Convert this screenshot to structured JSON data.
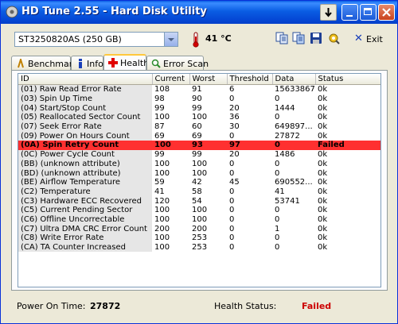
{
  "window": {
    "title": "HD Tune 2.55 - Hard Disk Utility"
  },
  "toolbar": {
    "drive": "ST3250820AS (250 GB)",
    "temperature": "41 °C",
    "exit_label": "Exit"
  },
  "tabs": [
    {
      "label": "Benchmark"
    },
    {
      "label": "Info"
    },
    {
      "label": "Health"
    },
    {
      "label": "Error Scan"
    }
  ],
  "table": {
    "columns": [
      "ID",
      "Current",
      "Worst",
      "Threshold",
      "Data",
      "Status"
    ],
    "rows": [
      [
        "(01) Raw Read Error Rate",
        "108",
        "91",
        "6",
        "15633867",
        "0k"
      ],
      [
        "(03) Spin Up Time",
        "98",
        "90",
        "0",
        "0",
        "0k"
      ],
      [
        "(04) Start/Stop Count",
        "99",
        "99",
        "20",
        "1444",
        "0k"
      ],
      [
        "(05) Reallocated Sector Count",
        "100",
        "100",
        "36",
        "0",
        "0k"
      ],
      [
        "(07) Seek Error Rate",
        "87",
        "60",
        "30",
        "649897...",
        "0k"
      ],
      [
        "(09) Power On Hours Count",
        "69",
        "69",
        "0",
        "27872",
        "0k"
      ],
      [
        "(0A) Spin Retry Count",
        "100",
        "93",
        "97",
        "0",
        "Failed"
      ],
      [
        "(0C) Power Cycle Count",
        "99",
        "99",
        "20",
        "1486",
        "0k"
      ],
      [
        "(BB) (unknown attribute)",
        "100",
        "100",
        "0",
        "0",
        "0k"
      ],
      [
        "(BD) (unknown attribute)",
        "100",
        "100",
        "0",
        "0",
        "0k"
      ],
      [
        "(BE) Airflow Temperature",
        "59",
        "42",
        "45",
        "690552...",
        "0k"
      ],
      [
        "(C2) Temperature",
        "41",
        "58",
        "0",
        "41",
        "0k"
      ],
      [
        "(C3) Hardware ECC Recovered",
        "120",
        "54",
        "0",
        "53741",
        "0k"
      ],
      [
        "(C5) Current Pending Sector",
        "100",
        "100",
        "0",
        "0",
        "0k"
      ],
      [
        "(C6) Offline Uncorrectable",
        "100",
        "100",
        "0",
        "0",
        "0k"
      ],
      [
        "(C7) Ultra DMA CRC Error Count",
        "200",
        "200",
        "0",
        "1",
        "0k"
      ],
      [
        "(C8) Write Error Rate",
        "100",
        "253",
        "0",
        "0",
        "0k"
      ],
      [
        "(CA) TA Counter Increased",
        "100",
        "253",
        "0",
        "0",
        "0k"
      ]
    ]
  },
  "footer": {
    "power_on_label": "Power On Time:",
    "power_on_value": "27872",
    "health_label": "Health Status:",
    "health_value": "Failed",
    "health_color": "#cc0000"
  },
  "colors": {
    "failed_row": "#ff3030",
    "titlebar": "#0a5de3",
    "tab_highlight": "#ffc83c"
  }
}
